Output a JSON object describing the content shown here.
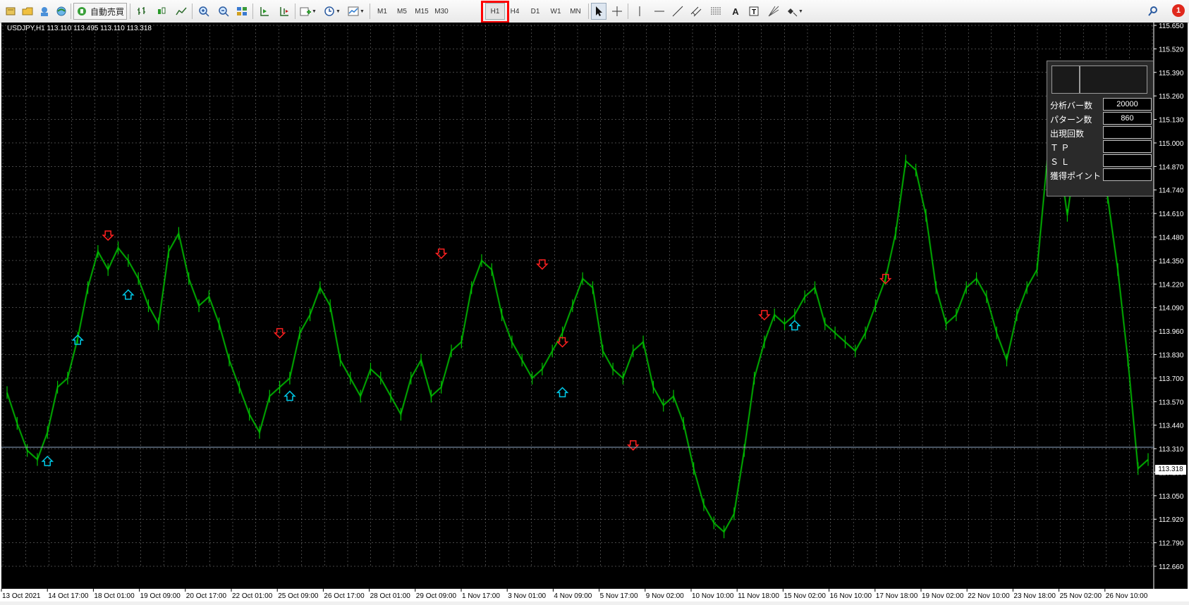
{
  "toolbar": {
    "auto_trade_label": "自動売買",
    "timeframes": [
      "M1",
      "M5",
      "M15",
      "M30",
      "H1",
      "H4",
      "D1",
      "W1",
      "MN"
    ],
    "selected_timeframe": "H1",
    "text_tool_label": "A",
    "notification_count": "1",
    "icons": [
      "new-order-icon",
      "open-folder-icon",
      "profile-icon",
      "globe-icon",
      "expert-advisors-icon",
      "bar-chart-icon",
      "candlestick-icon",
      "line-chart-icon",
      "zoom-in-icon",
      "zoom-out-icon",
      "tile-windows-icon",
      "chart-shift-icon",
      "auto-scroll-icon",
      "indicators-icon",
      "periods-icon",
      "templates-icon",
      "cursor-icon",
      "crosshair-icon",
      "vertical-line-icon",
      "horizontal-line-icon",
      "trendline-icon",
      "channel-icon",
      "fibonacci-icon",
      "text-icon",
      "label-icon",
      "gann-icon",
      "shapes-icon",
      "search-icon",
      "notification-icon"
    ]
  },
  "chart": {
    "title": "USDJPY,H1  113.110 113.495 113.110 113.318",
    "current_price": "113.318",
    "colors": {
      "background": "#000000",
      "grid": "#ffffff",
      "candle": "#00c000",
      "sell_arrow": "#ff2020",
      "buy_arrow": "#00c8e6",
      "price_line": "#8fa7c4"
    }
  },
  "chart_data": {
    "type": "line",
    "symbol": "USDJPY",
    "timeframe": "H1",
    "ylim": [
      112.66,
      115.65
    ],
    "y_ticks": [
      "115.650",
      "115.520",
      "115.390",
      "115.260",
      "115.130",
      "115.000",
      "114.870",
      "114.740",
      "114.610",
      "114.480",
      "114.350",
      "114.220",
      "114.090",
      "113.960",
      "113.830",
      "113.700",
      "113.570",
      "113.440",
      "113.310",
      "113.180",
      "113.050",
      "112.920",
      "112.790",
      "112.660"
    ],
    "x_labels": [
      "13 Oct 2021",
      "14 Oct 17:00",
      "18 Oct 01:00",
      "19 Oct 09:00",
      "20 Oct 17:00",
      "22 Oct 01:00",
      "25 Oct 09:00",
      "26 Oct 17:00",
      "28 Oct 01:00",
      "29 Oct 09:00",
      "1 Nov 17:00",
      "3 Nov 01:00",
      "4 Nov 09:00",
      "5 Nov 17:00",
      "9 Nov 02:00",
      "10 Nov 10:00",
      "11 Nov 18:00",
      "15 Nov 02:00",
      "16 Nov 10:00",
      "17 Nov 18:00",
      "19 Nov 02:00",
      "22 Nov 10:00",
      "23 Nov 18:00",
      "25 Nov 02:00",
      "26 Nov 10:00"
    ],
    "series": [
      {
        "values": [
          113.62,
          113.45,
          113.3,
          113.25,
          113.4,
          113.65,
          113.7,
          113.92,
          114.2,
          114.4,
          114.3,
          114.42,
          114.35,
          114.25,
          114.1,
          114.0,
          114.4,
          114.5,
          114.25,
          114.1,
          114.15,
          114.0,
          113.8,
          113.65,
          113.5,
          113.4,
          113.6,
          113.65,
          113.7,
          113.95,
          114.05,
          114.2,
          114.1,
          113.8,
          113.7,
          113.6,
          113.75,
          113.7,
          113.6,
          113.5,
          113.7,
          113.8,
          113.6,
          113.65,
          113.85,
          113.9,
          114.2,
          114.35,
          114.3,
          114.05,
          113.9,
          113.8,
          113.7,
          113.75,
          113.85,
          113.95,
          114.1,
          114.25,
          114.2,
          113.85,
          113.75,
          113.7,
          113.85,
          113.9,
          113.65,
          113.55,
          113.6,
          113.45,
          113.2,
          113.0,
          112.9,
          112.85,
          112.95,
          113.3,
          113.7,
          113.9,
          114.05,
          114.0,
          114.05,
          114.15,
          114.2,
          114.0,
          113.95,
          113.9,
          113.85,
          113.95,
          114.1,
          114.25,
          114.5,
          114.9,
          114.85,
          114.6,
          114.2,
          114.0,
          114.05,
          114.2,
          114.25,
          114.15,
          113.95,
          113.8,
          114.05,
          114.2,
          114.3,
          114.9,
          115.0,
          114.6,
          115.0,
          115.1,
          114.8,
          114.7,
          114.3,
          113.8,
          113.2,
          113.25
        ]
      }
    ],
    "markers": [
      {
        "type": "sell",
        "x_index": 10,
        "price": 114.49
      },
      {
        "type": "buy",
        "x_index": 12,
        "price": 114.16
      },
      {
        "type": "buy",
        "x_index": 4,
        "price": 113.24
      },
      {
        "type": "buy",
        "x_index": 7,
        "price": 113.91
      },
      {
        "type": "sell",
        "x_index": 27,
        "price": 113.95
      },
      {
        "type": "buy",
        "x_index": 28,
        "price": 113.6
      },
      {
        "type": "sell",
        "x_index": 43,
        "price": 114.39
      },
      {
        "type": "sell",
        "x_index": 53,
        "price": 114.33
      },
      {
        "type": "sell",
        "x_index": 55,
        "price": 113.9
      },
      {
        "type": "buy",
        "x_index": 55,
        "price": 113.62
      },
      {
        "type": "sell",
        "x_index": 62,
        "price": 113.33
      },
      {
        "type": "sell",
        "x_index": 75,
        "price": 114.05
      },
      {
        "type": "buy",
        "x_index": 78,
        "price": 113.99
      },
      {
        "type": "sell",
        "x_index": 87,
        "price": 114.25
      }
    ],
    "current_price": 113.318
  },
  "panel": {
    "rows": [
      {
        "label": "分析バー数",
        "value": "20000"
      },
      {
        "label": "パターン数",
        "value": "860"
      },
      {
        "label": "出現回数",
        "value": ""
      },
      {
        "label": "Ｔ Ｐ",
        "value": ""
      },
      {
        "label": "Ｓ Ｌ",
        "value": ""
      },
      {
        "label": "獲得ポイント",
        "value": ""
      }
    ]
  }
}
